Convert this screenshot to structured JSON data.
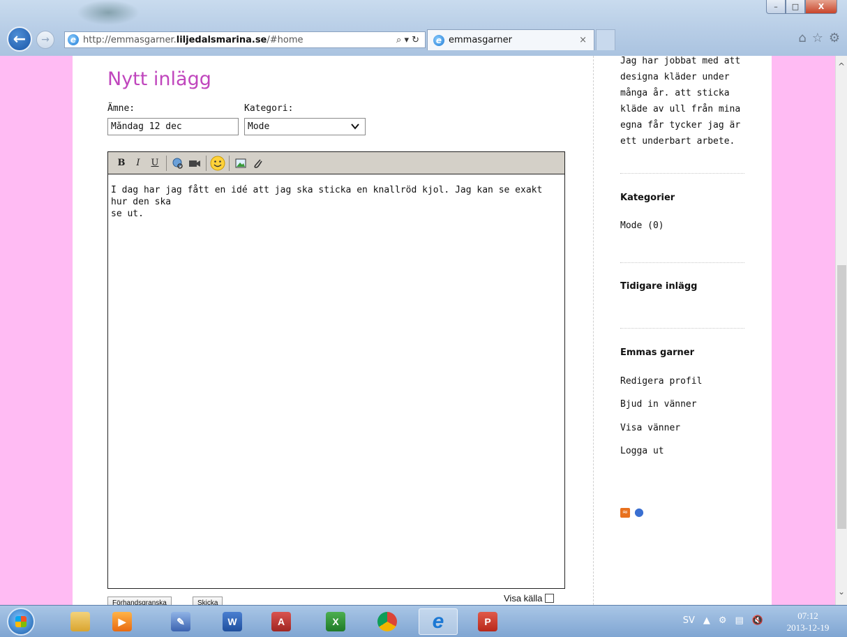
{
  "browser": {
    "url_prefix": "http://emmasgarner.",
    "url_host": "liljedalsmarina.se",
    "url_suffix": "/#home",
    "address_tools": "⌕ ▾ ↻",
    "tab_title": "emmasgarner",
    "tab_close": "×",
    "window_buttons": {
      "minimize": "–",
      "maximize": "□",
      "close": "X"
    },
    "icons": [
      "home-icon",
      "favorites-star-icon",
      "settings-gear-icon"
    ]
  },
  "post_form": {
    "title": "Nytt inlägg",
    "subject_label": "Ämne:",
    "subject_value": "Måndag 12 dec",
    "category_label": "Kategori:",
    "category_value": "Mode",
    "body_text": "I dag har jag fått en idé att jag ska sticka en knallröd kjol. Jag kan se exakt hur den ska\nse ut.",
    "toolbar": {
      "bold": "B",
      "italic": "I",
      "underline": "U"
    },
    "preview_button": "Förhandsgranska",
    "send_button": "Skicka",
    "show_source_label": "Visa källa",
    "show_source_checked": false
  },
  "sidebar": {
    "about_text": "Jag har jobbat med att designa kläder under många år. att sticka kläde av ull från mina egna får tycker jag är ett underbart arbete.",
    "categories_heading": "Kategorier",
    "categories": [
      "Mode (0)"
    ],
    "earlier_posts_heading": "Tidigare inlägg",
    "profile_heading": "Emmas garner",
    "profile_links": [
      "Redigera profil",
      "Bjud in vänner",
      "Visa vänner",
      "Logga ut"
    ]
  },
  "taskbar": {
    "language": "SV",
    "time": "07:12",
    "date": "2013-12-19",
    "apps": [
      "windows-explorer",
      "media-player",
      "paint",
      "word",
      "access",
      "excel",
      "chrome",
      "internet-explorer",
      "powerpoint"
    ]
  },
  "colors": {
    "page_background": "#ffbbf3",
    "title_color": "#c046bd",
    "toolbar_gray": "#d4d0c8"
  }
}
